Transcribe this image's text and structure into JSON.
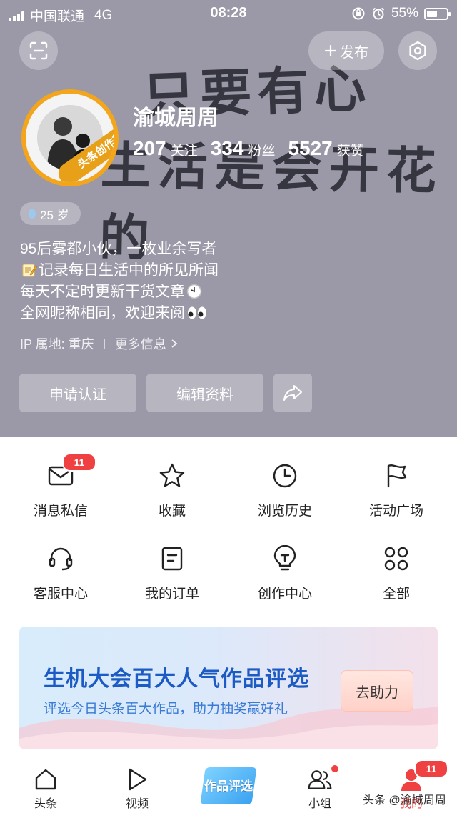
{
  "status_bar": {
    "carrier": "中国联通",
    "network": "4G",
    "time": "08:28",
    "battery_percent": "55%",
    "battery_level": 0.55
  },
  "header": {
    "publish_label": "发布",
    "username": "渝城周周",
    "avatar_badge": "头条创作新锐奖",
    "background_text_line1": "只要有心",
    "background_text_line2": "生活是会开花的",
    "stats": [
      {
        "value": "207",
        "label": "关注"
      },
      {
        "value": "334",
        "label": "粉丝"
      },
      {
        "value": "5527",
        "label": "获赞"
      }
    ],
    "age": "25 岁",
    "bio": [
      "95后雾都小伙，一枚业余写者",
      "记录每日生活中的所见所闻",
      "每天不定时更新干货文章",
      "全网昵称相同，欢迎来阅"
    ],
    "ip_location": "IP 属地: 重庆",
    "more_info": "更多信息",
    "apply_cert": "申请认证",
    "edit_profile": "编辑资料"
  },
  "menu": {
    "items": [
      {
        "label": "消息私信",
        "icon": "mail-icon",
        "badge": "11"
      },
      {
        "label": "收藏",
        "icon": "star-icon"
      },
      {
        "label": "浏览历史",
        "icon": "clock-icon"
      },
      {
        "label": "活动广场",
        "icon": "flag-icon"
      },
      {
        "label": "客服中心",
        "icon": "headset-icon"
      },
      {
        "label": "我的订单",
        "icon": "order-icon"
      },
      {
        "label": "创作中心",
        "icon": "lightbulb-icon"
      },
      {
        "label": "全部",
        "icon": "grid-icon"
      }
    ]
  },
  "banner": {
    "title": "生机大会百大人气作品评选",
    "subtitle": "评选今日头条百大作品，助力抽奖赢好礼",
    "button": "去助力"
  },
  "tabbar": {
    "tabs": [
      {
        "label": "头条",
        "icon": "home-icon"
      },
      {
        "label": "视频",
        "icon": "play-icon"
      },
      {
        "label": "作品评选",
        "icon": "vote-icon"
      },
      {
        "label": "小组",
        "icon": "group-icon"
      },
      {
        "label": "我的",
        "icon": "profile-icon",
        "badge": "11"
      }
    ],
    "watermark": "头条 @渝城周周"
  },
  "colors": {
    "header_bg": "#9b99a8",
    "accent_red": "#f04142",
    "banner_blue": "#1d5bc4",
    "avatar_ring": "#f3a51c"
  }
}
